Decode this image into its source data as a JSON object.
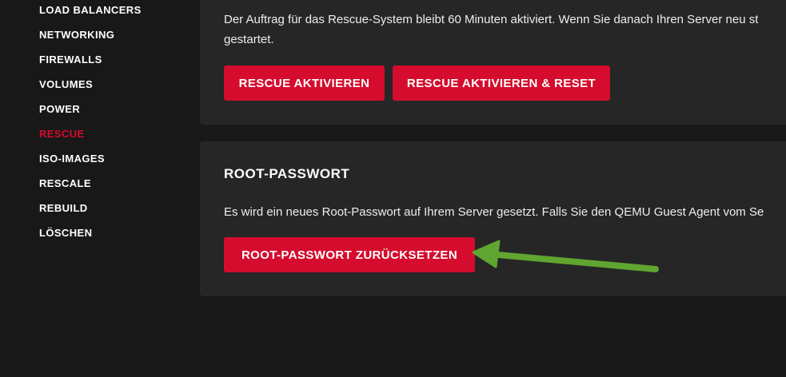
{
  "sidebar": {
    "items": [
      {
        "label": "LOAD BALANCERS"
      },
      {
        "label": "NETWORKING"
      },
      {
        "label": "FIREWALLS"
      },
      {
        "label": "VOLUMES"
      },
      {
        "label": "POWER"
      },
      {
        "label": "RESCUE",
        "active": true
      },
      {
        "label": "ISO-IMAGES"
      },
      {
        "label": "RESCALE"
      },
      {
        "label": "REBUILD"
      },
      {
        "label": "LÖSCHEN"
      }
    ]
  },
  "rescue_card": {
    "description_line1": "Der Auftrag für das Rescue-System bleibt 60 Minuten aktiviert. Wenn Sie danach Ihren Server neu st",
    "description_line2": "gestartet.",
    "activate_button": "RESCUE AKTIVIEREN",
    "activate_reset_button": "RESCUE AKTIVIEREN & RESET"
  },
  "root_password_card": {
    "title": "ROOT-PASSWORT",
    "description": "Es wird ein neues Root-Passwort auf Ihrem Server gesetzt. Falls Sie den QEMU Guest Agent vom Se",
    "reset_button": "ROOT-PASSWORT ZURÜCKSETZEN"
  },
  "colors": {
    "accent": "#d50c2d",
    "annotation_arrow": "#5fa530",
    "background": "#181818",
    "card": "#262626"
  }
}
